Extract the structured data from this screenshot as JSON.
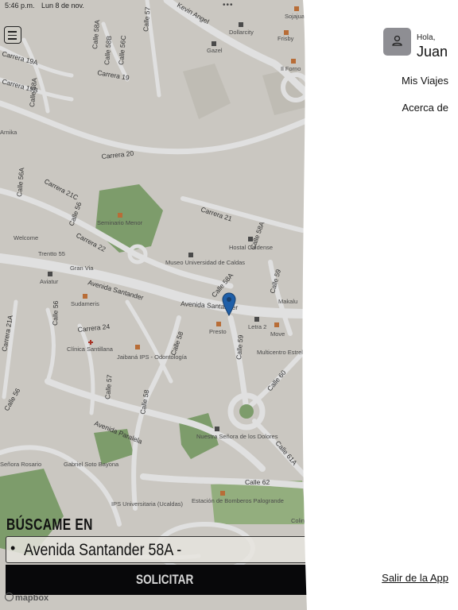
{
  "status_bar": {
    "time": "5:46 p.m.",
    "date": "Lun 8 de nov.",
    "battery_color": "#34c759"
  },
  "map": {
    "streets": [
      "Calle 57",
      "Calle 58A",
      "Calle 58B",
      "Calle 56C",
      "Carrera 19",
      "Calle 58A",
      "Carrera 20",
      "Carrera 21C",
      "Calle 56",
      "Calle 56A",
      "Carrera 21",
      "Carrera 22",
      "Avenida Santander",
      "Avenida Santander",
      "Carrera 24",
      "Calle 56",
      "Calle 58",
      "Calle 59",
      "Calle 59",
      "Calle 60",
      "Calle 57",
      "Calle 58",
      "Calle 56",
      "Avenida Paralela",
      "Calle 61A",
      "Calle 62",
      "Carrera 21A",
      "Calle 58A",
      "Calle 58A",
      "Carrera 19A",
      "Carrera 19B",
      "Kevin Angel"
    ],
    "places": [
      "Sojajuan",
      "Dollarcity",
      "Frisby",
      "Gazel",
      "Il Forno",
      "Arnika",
      "Seminario Menor",
      "Welcome",
      "Trentto 55",
      "Gran Via",
      "Museo Universidad de Caldas",
      "Hostal Caldense",
      "Aviatur",
      "Sudameris",
      "Makalu",
      "Letra 2",
      "Presto",
      "Move",
      "Multicentro Estrella",
      "Clínica Santillana",
      "Jaibaná IPS - Odontología",
      "Nuestra Señora de los Dolores",
      "Gabriel Soto Bayona",
      "Señora Rosario",
      "IPS Universitaria (Ucaldas)",
      "Estación de Bomberos Palogrande",
      "Colina"
    ],
    "attribution": "mapbox"
  },
  "search": {
    "title": "BÚSCAME EN",
    "bullet": "•",
    "value": "Avenida Santander 58A -"
  },
  "request_button": {
    "label": "SOLICITAR"
  },
  "drawer": {
    "greeting": "Hola,",
    "user_name": "Juan",
    "items": [
      {
        "label": "Mis Viajes"
      },
      {
        "label": "Acerca de"
      }
    ],
    "logout_label": "Salir de la App",
    "avatar_icon": "person-icon",
    "avatar_color": "#8e8e93"
  },
  "colors": {
    "button_bg": "#08080a",
    "pin": "#1f5fa8",
    "park": "#5f9e5f"
  }
}
